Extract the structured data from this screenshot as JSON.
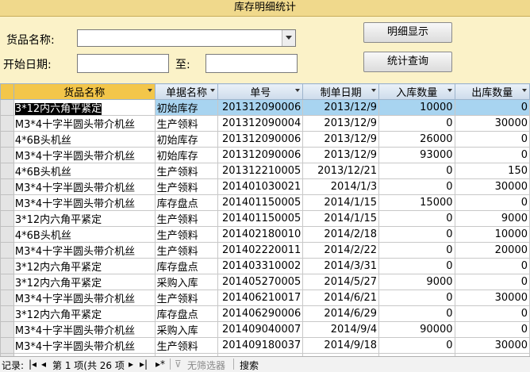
{
  "title": "库存明细统计",
  "form": {
    "goods_label": "货品名称:",
    "start_label": "开始日期:",
    "to_label": "至:",
    "detail_button": "明细显示",
    "stats_button": "统计查询"
  },
  "grid": {
    "columns": [
      "货品名称",
      "单据名称",
      "单号",
      "制单日期",
      "入库数量",
      "出库数量"
    ],
    "rows": [
      [
        "3*12内六角平紧定",
        "初始库存",
        "201312090006",
        "2013/12/9",
        "10000",
        "0"
      ],
      [
        "M3*4十字半圆头带介机丝",
        "生产领料",
        "201312090004",
        "2013/12/9",
        "0",
        "30000"
      ],
      [
        "4*6B头机丝",
        "初始库存",
        "201312090006",
        "2013/12/9",
        "26000",
        "0"
      ],
      [
        "M3*4十字半圆头带介机丝",
        "初始库存",
        "201312090006",
        "2013/12/9",
        "93000",
        "0"
      ],
      [
        "4*6B头机丝",
        "生产领料",
        "201312210005",
        "2013/12/21",
        "0",
        "150"
      ],
      [
        "M3*4十字半圆头带介机丝",
        "生产领料",
        "201401030021",
        "2014/1/3",
        "0",
        "30000"
      ],
      [
        "M3*4十字半圆头带介机丝",
        "库存盘点",
        "201401150005",
        "2014/1/15",
        "15000",
        "0"
      ],
      [
        "3*12内六角平紧定",
        "生产领料",
        "201401150005",
        "2014/1/15",
        "0",
        "9000"
      ],
      [
        "4*6B头机丝",
        "生产领料",
        "201402180010",
        "2014/2/18",
        "0",
        "10000"
      ],
      [
        "M3*4十字半圆头带介机丝",
        "生产领料",
        "201402220011",
        "2014/2/22",
        "0",
        "20000"
      ],
      [
        "3*12内六角平紧定",
        "库存盘点",
        "201403310002",
        "2014/3/31",
        "0",
        "0"
      ],
      [
        "3*12内六角平紧定",
        "采购入库",
        "201405270005",
        "2014/5/27",
        "9000",
        "0"
      ],
      [
        "M3*4十字半圆头带介机丝",
        "生产领料",
        "201406210017",
        "2014/6/21",
        "0",
        "30000"
      ],
      [
        "3*12内六角平紧定",
        "库存盘点",
        "201406290006",
        "2014/6/29",
        "0",
        "0"
      ],
      [
        "M3*4十字半圆头带介机丝",
        "采购入库",
        "201409040007",
        "2014/9/4",
        "90000",
        "0"
      ],
      [
        "M3*4十字半圆头带介机丝",
        "生产领料",
        "201409180037",
        "2014/9/18",
        "0",
        "30000"
      ],
      [
        "3*12内六角平紧定",
        "采购入库",
        "201409230005",
        "2014/9/23",
        "800",
        "0"
      ]
    ]
  },
  "navigation": {
    "record_label": "记录:",
    "record_position": "第 1 项(共 26 项",
    "filter_label": "无筛选器",
    "search_label": "搜索"
  }
}
